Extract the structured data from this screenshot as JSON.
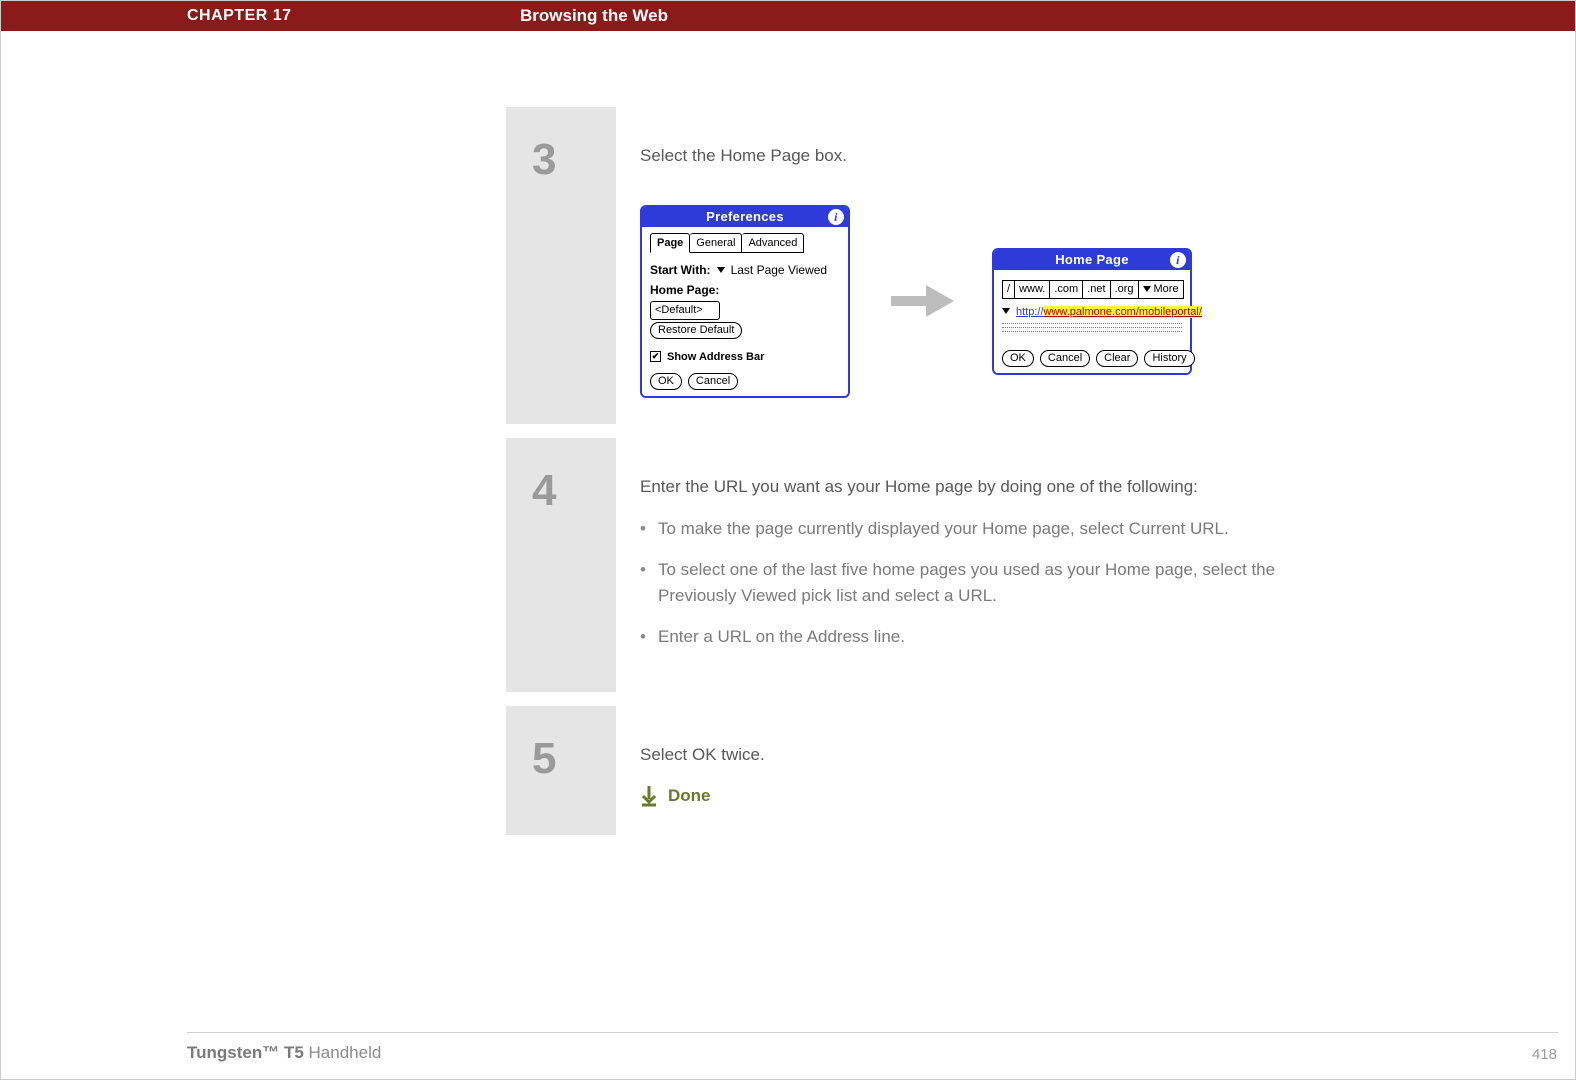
{
  "header": {
    "chapter_label": "CHAPTER 17",
    "chapter_title": "Browsing the Web"
  },
  "steps": {
    "s3": {
      "number": "3",
      "lead": "Select the Home Page box.",
      "prefs": {
        "title": "Preferences",
        "tabs": {
          "page": "Page",
          "general": "General",
          "advanced": "Advanced"
        },
        "start_with_label": "Start With:",
        "start_with_value": "Last Page Viewed",
        "home_page_label": "Home Page:",
        "home_page_value": "<Default>",
        "restore_default": "Restore Default",
        "show_addr": "Show Address Bar",
        "ok": "OK",
        "cancel": "Cancel"
      },
      "home": {
        "title": "Home Page",
        "btn_slash": "/",
        "btn_www": "www.",
        "btn_com": ".com",
        "btn_net": ".net",
        "btn_org": ".org",
        "btn_more": "More",
        "url_pre": "http://",
        "url_hi": "www.palmone.com/mobileportal/",
        "ok": "OK",
        "cancel": "Cancel",
        "clear": "Clear",
        "history": "History"
      }
    },
    "s4": {
      "number": "4",
      "lead": "Enter the URL you want as your Home page by doing one of the following:",
      "b1": "To make the page currently displayed your Home page, select Current URL.",
      "b2": "To select one of the last five home pages you used as your Home page, select the Previously Viewed pick list and select a URL.",
      "b3": "Enter a URL on the Address line."
    },
    "s5": {
      "number": "5",
      "lead": "Select OK twice.",
      "done": "Done"
    }
  },
  "footer": {
    "product_strong": "Tungsten™ T5",
    "product_rest": " Handheld",
    "page_no": "418"
  }
}
